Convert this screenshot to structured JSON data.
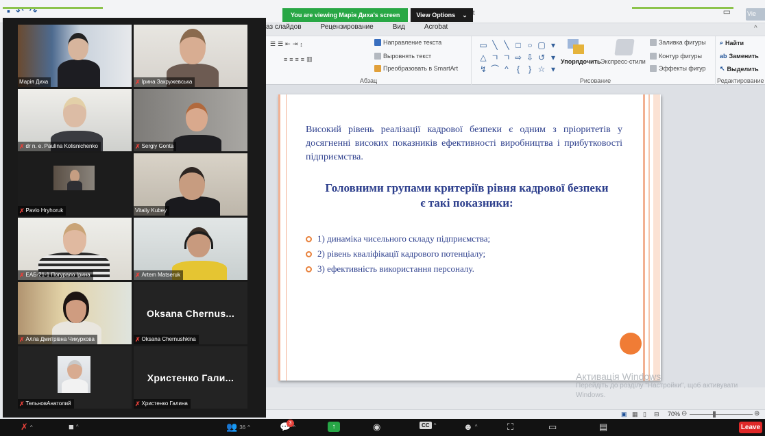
{
  "zoom_banner": {
    "viewing_text": "You are viewing Марія Диха's screen",
    "view_options_label": "View Options",
    "view_options_icon": "chevron-down-icon"
  },
  "powerpoint": {
    "title_fragment": "int",
    "window_vie_label": "Vie",
    "tabs": [
      "аз слайдов",
      "Рецензирование",
      "Вид",
      "Acrobat"
    ],
    "ribbon": {
      "paragraph": {
        "text_direction": "Направление текста",
        "align_text": "Выровнять текст",
        "convert_smartart": "Преобразовать в SmartArt",
        "caption": "Абзац"
      },
      "drawing": {
        "arrange": "Упорядочить",
        "quick_styles": "Экспресс-стили",
        "shape_fill": "Заливка фигуры",
        "shape_outline": "Контур фигуры",
        "shape_effects": "Эффекты фигур",
        "caption": "Рисование"
      },
      "editing": {
        "find": "Найти",
        "replace": "Заменить",
        "select": "Выделить",
        "caption": "Редактирование"
      }
    },
    "slide": {
      "intro": "Високий рівень реалізації кадрової безпеки є одним з пріоритетів у досягненні високих показників ефективності виробництва і прибутковості підприємства.",
      "heading_line1": "Головними групами критеріїв рівня кадрової безпеки",
      "heading_line2": "є такі показники:",
      "bullets": [
        "1) динаміка чисельного складу підприємства;",
        "2) рівень кваліфікації кадрового потенціалу;",
        "3) ефективність використання персоналу."
      ],
      "accent_color": "#f07c35",
      "text_color": "#2c3e8c"
    },
    "zoom_level": "70%",
    "windows_watermark": {
      "title": "Активація Windows",
      "line": "Перейдіть до розділу \"Настройки\", щоб активувати Windows."
    }
  },
  "participants": [
    {
      "name": "Марія Диха",
      "muted": false,
      "kind": "video"
    },
    {
      "name": "Ірина Закружевська",
      "muted": true,
      "kind": "video"
    },
    {
      "name": "dr n. e. Paulina Kolisnichenko",
      "muted": true,
      "kind": "video"
    },
    {
      "name": "Sergiy Gonta",
      "muted": true,
      "kind": "video"
    },
    {
      "name": "Pavlo Hryhoruk",
      "muted": true,
      "kind": "video"
    },
    {
      "name": "Vitaliy Kubey",
      "muted": false,
      "kind": "video",
      "active_speaker": true
    },
    {
      "name": "ЕАБ-21-1 Погурало Ірина",
      "muted": true,
      "kind": "video"
    },
    {
      "name": "Artem Matseruk",
      "muted": true,
      "kind": "video"
    },
    {
      "name": "Алла Дмитрівна Чикуркова",
      "muted": true,
      "kind": "video"
    },
    {
      "name": "Oksana Chernushkina",
      "muted": true,
      "kind": "name",
      "display": "Oksana Chernus..."
    },
    {
      "name": "ТельновАнатолий",
      "muted": true,
      "kind": "photo"
    },
    {
      "name": "Христенко Галина",
      "muted": true,
      "kind": "name",
      "display": "Христенко Гали..."
    }
  ],
  "toolbar": {
    "participants_count": "36",
    "chat_badge": "3",
    "cc_label": "CC",
    "leave_label": "Leave"
  }
}
